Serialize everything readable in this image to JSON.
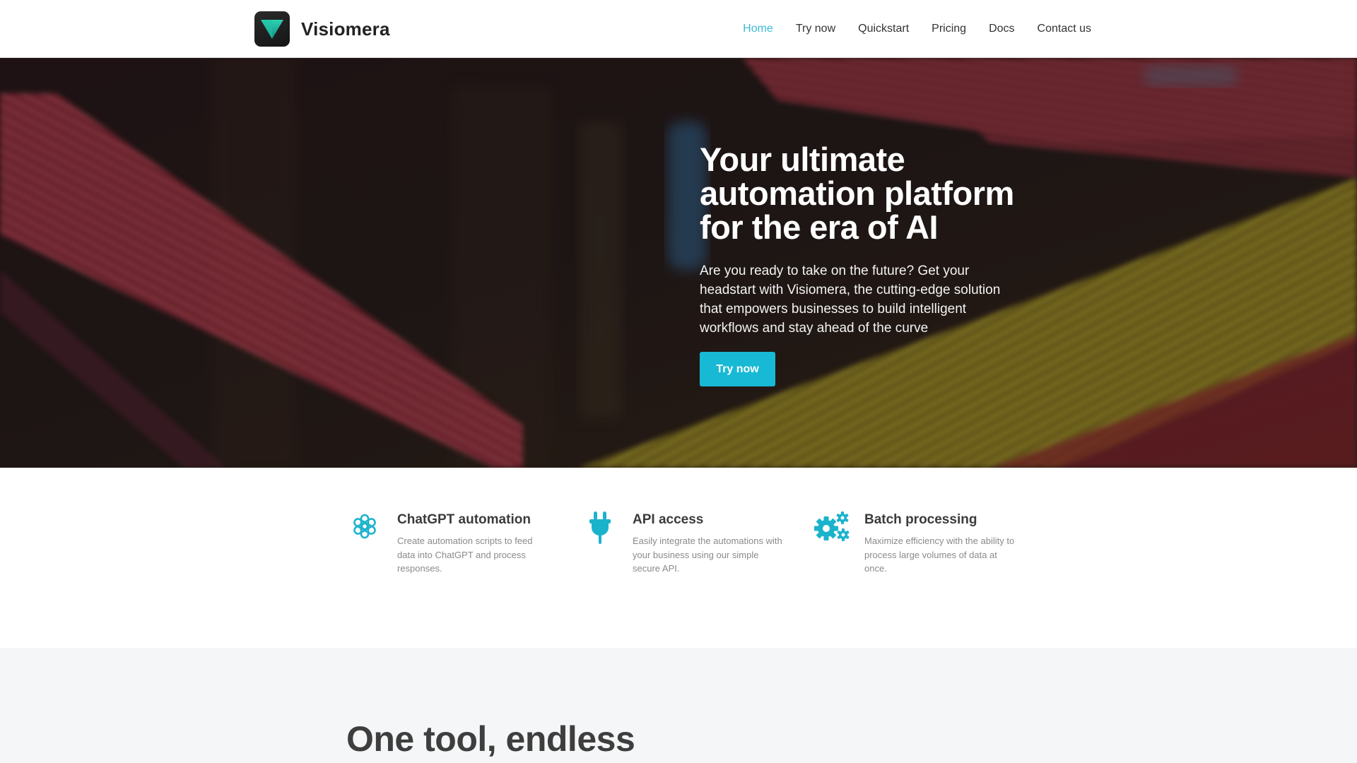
{
  "brand": {
    "name": "Visiomera",
    "logo_icon": "triangle-down-logo-icon",
    "logo_color": "#1fb8a0"
  },
  "nav": {
    "items": [
      {
        "label": "Home",
        "active": true
      },
      {
        "label": "Try now",
        "active": false
      },
      {
        "label": "Quickstart",
        "active": false
      },
      {
        "label": "Pricing",
        "active": false
      },
      {
        "label": "Docs",
        "active": false
      },
      {
        "label": "Contact us",
        "active": false
      }
    ],
    "active_color": "#3cbcd4"
  },
  "hero": {
    "title": "Your ultimate automation platform for the era of AI",
    "text": "Are you ready to take on the future? Get your headstart with Visiomera, the cutting-edge solution that empowers businesses to build intelligent workflows and stay ahead of the curve",
    "cta_label": "Try now",
    "cta_color": "#17b9d5"
  },
  "features": [
    {
      "icon": "openai-knot-icon",
      "title": "ChatGPT automation",
      "desc": "Create automation scripts to feed data into ChatGPT and process responses."
    },
    {
      "icon": "plug-icon",
      "title": "API access",
      "desc": "Easily integrate the automations with your business using our simple secure API."
    },
    {
      "icon": "gears-icon",
      "title": "Batch processing",
      "desc": "Maximize efficiency with the ability to process large volumes of data at once."
    }
  ],
  "section2": {
    "title": "One tool, endless"
  },
  "colors": {
    "accent": "#17b9d5",
    "icon": "#1bb3cc"
  }
}
